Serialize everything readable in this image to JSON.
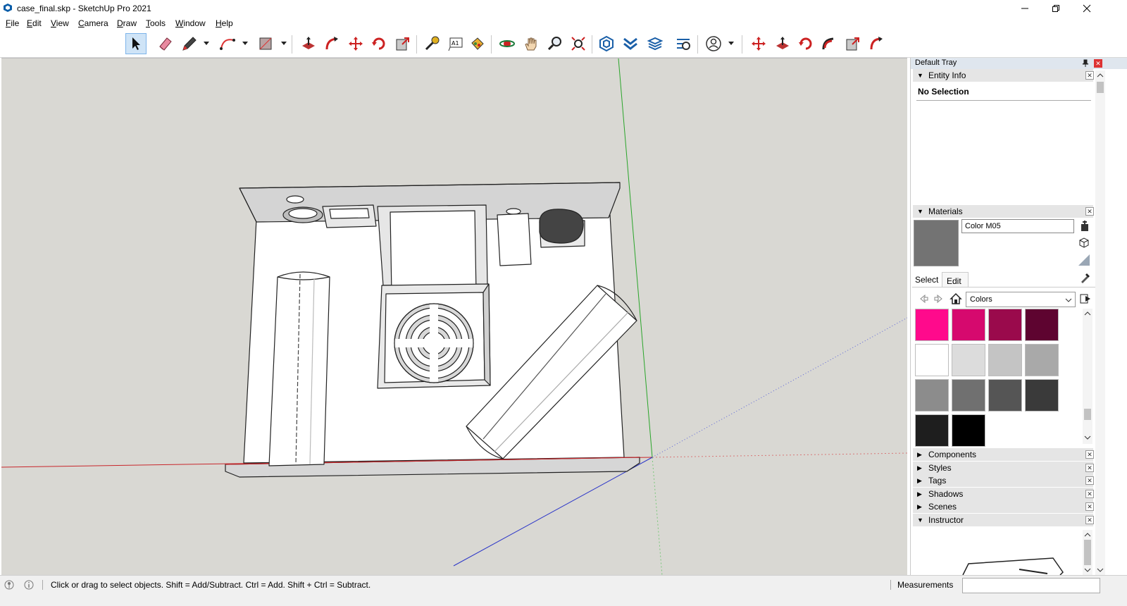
{
  "window": {
    "title": "case_final.skp - SketchUp Pro 2021"
  },
  "menu": [
    "File",
    "Edit",
    "View",
    "Camera",
    "Draw",
    "Tools",
    "Window",
    "Help"
  ],
  "tray": {
    "title": "Default Tray",
    "entity_info": {
      "title": "Entity Info",
      "selection": "No Selection"
    },
    "materials": {
      "title": "Materials",
      "material_name": "Color M05",
      "preview_color": "#737373",
      "tabs": [
        "Select",
        "Edit"
      ],
      "library": "Colors",
      "swatches": [
        "#ff0a8c",
        "#d6096e",
        "#9a0a4c",
        "#5e0430",
        "#ffffff",
        "#dcdcdc",
        "#c4c4c4",
        "#a9a9a9",
        "#8c8c8c",
        "#707070",
        "#555555",
        "#3a3a3a",
        "#1e1e1e",
        "#000000"
      ]
    },
    "collapsed_panels": [
      "Components",
      "Styles",
      "Tags",
      "Shadows",
      "Scenes"
    ],
    "instructor": {
      "title": "Instructor"
    }
  },
  "status": {
    "message": "Click or drag to select objects. Shift = Add/Subtract. Ctrl = Add. Shift + Ctrl = Subtract.",
    "measurements_label": "Measurements",
    "measurements_value": ""
  }
}
